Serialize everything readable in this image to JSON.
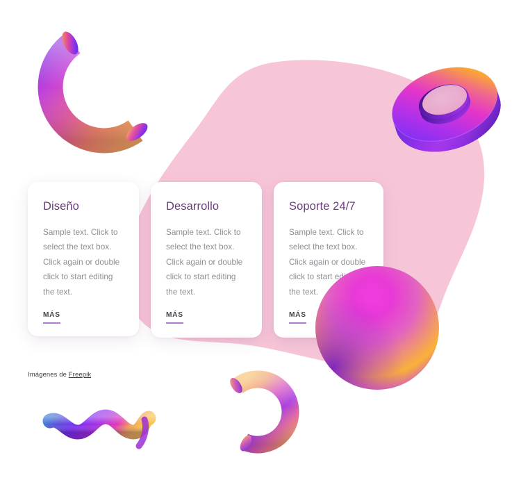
{
  "page": {
    "background_color": "#ffffff",
    "blob_color": "#f7c5d8"
  },
  "cards": [
    {
      "id": "diseno",
      "title": "Diseño",
      "body": "Sample text. Click to select the text box. Click again or double click to start editing the text.",
      "link_label": "MÁS"
    },
    {
      "id": "desarrollo",
      "title": "Desarrollo",
      "body": "Sample text. Click to select the text box. Click again or double click to start editing the text.",
      "link_label": "MÁS"
    },
    {
      "id": "soporte",
      "title": "Soporte 24/7",
      "body": "Sample text. Click to select the text box. Click again or double click to start editing the text.",
      "link_label": "MÁS"
    }
  ],
  "credit": {
    "prefix": "Imágenes de ",
    "link_label": "Freepik"
  },
  "theme": {
    "title_color": "#6c3c7d",
    "body_color": "#8d8d94",
    "link_color": "#45454d",
    "link_underline_color": "#ab7fcf",
    "card_background": "#ffffff"
  },
  "decorations": [
    {
      "name": "c-arc-tube-top-left",
      "shape": "open-c-tube",
      "gradient": [
        "#7b2ff7",
        "#e martian",
        "#f9a03f"
      ],
      "position": "top-left"
    },
    {
      "name": "torus-ring-top-right",
      "shape": "tilted-3d-torus",
      "gradient": [
        "#7b2ff7",
        "#e535c9",
        "#f9b234"
      ],
      "position": "top-right"
    },
    {
      "name": "gradient-sphere-right",
      "shape": "sphere",
      "gradient": [
        "#6f1fb5",
        "#e336d8",
        "#f9ae2f"
      ],
      "position": "middle-right"
    },
    {
      "name": "zigzag-ribbon-bottom-left",
      "shape": "wave-ribbon",
      "gradient": [
        "#3f7ad6",
        "#7b2ff7",
        "#e336b4",
        "#f9b234"
      ],
      "position": "bottom-left"
    },
    {
      "name": "c-arc-tube-bottom-center",
      "shape": "open-c-tube",
      "gradient": [
        "#f2b06a",
        "#c44ae0",
        "#8a2be2"
      ],
      "position": "bottom-center"
    },
    {
      "name": "pink-organic-blob",
      "shape": "blob",
      "color": "#f7c5d8",
      "position": "center"
    }
  ]
}
